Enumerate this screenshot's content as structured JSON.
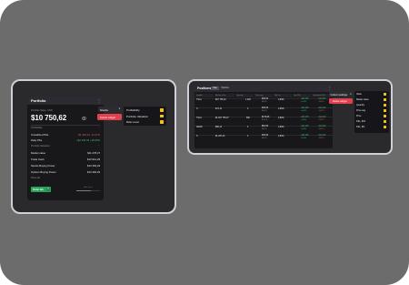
{
  "portfolio": {
    "title": "Portfolio",
    "menu_icon": "kebab-icon",
    "net_value_label": "Portfolio Value, USD",
    "net_value": "$10 750,62",
    "eye_icon": "eye-icon",
    "profitability_section": "Profitability",
    "rows_pl": [
      {
        "label": "Unrealized P&L",
        "value": "-$1 440.94  -13.47%",
        "tone": "neg"
      },
      {
        "label": "Daily P&L",
        "value": "+$2 446.33  +18.66%",
        "tone": "pos"
      }
    ],
    "valuation_section": "Portfolio Valuation",
    "rows_val": [
      {
        "label": "Market value",
        "value": "$11 278,07"
      },
      {
        "label": "Trade Cash",
        "value": "$10 612,29"
      },
      {
        "label": "Stocks Buying Power",
        "value": "$10 393,29"
      },
      {
        "label": "Options Buying Power",
        "value": "$10 393,29"
      }
    ],
    "show_all": "Show all",
    "primary_button": "Order tab",
    "slider_label": "Risk level",
    "slider_fraction": 0.6
  },
  "stocks_dropdown": {
    "label": "Stocks",
    "delete_label": "Delete widget"
  },
  "portfolio_props": [
    {
      "label": "Profitability"
    },
    {
      "label": "Portfolio Valuation"
    },
    {
      "label": "Risk Level"
    }
  ],
  "positions": {
    "title": "Positions",
    "tabs": [
      {
        "label": "Own",
        "active": true
      },
      {
        "label": "Options",
        "active": false
      }
    ],
    "menu_icon": "kebab-icon",
    "columns": [
      "Symbol",
      "Market value",
      "Quantity",
      "Price avg",
      "Net Liq",
      "Day P&L",
      "Unrealized P&L"
    ],
    "rows": [
      {
        "symbol": "TSLA",
        "market": "$67 755,20",
        "qty": "1 000",
        "avg": "$45,05",
        "avg_sub": "$44,16",
        "net": "2,89%",
        "day": "+$2 445",
        "day_sub": "+4,43%",
        "unr": "+$1 020",
        "unr_sub": "-13,47%"
      },
      {
        "symbol": "S",
        "market": "$73,14",
        "qty": "2",
        "avg": "$45,05",
        "avg_sub": "$44,16",
        "net": "2,89%",
        "day": "+$2 445",
        "day_sub": "+4,43%",
        "unr": "+$1 020",
        "unr_sub": "-13,47%"
      },
      {
        "symbol": "TSLA",
        "market": "$1 007 755,07",
        "qty": "800",
        "avg": "$179,08",
        "avg_sub": "$175,41",
        "net": "2,89%",
        "day": "+$2 445",
        "day_sub": "+4,43%",
        "unr": "+$1 020",
        "unr_sub": "-13,47%"
      },
      {
        "symbol": "AMZN",
        "market": "$85,14",
        "qty": "4",
        "avg": "$52,58",
        "avg_sub": "$44,16",
        "net": "2,89%",
        "day": "+$2 445",
        "day_sub": "+4,43%",
        "unr": "+$1 020",
        "unr_sub": "-13,47%"
      },
      {
        "symbol": "S",
        "market": "$1 297,20",
        "qty": "2",
        "avg": "$45,05",
        "avg_sub": "$44,16",
        "net": "2,89%",
        "day": "+$2 445",
        "day_sub": "+4,43%",
        "unr": "+$1 020",
        "unr_sub": "-13,47%"
      }
    ],
    "dropdown_label": "Column settings",
    "delete_label": "Delete widget"
  },
  "column_settings": [
    {
      "label": "Value"
    },
    {
      "label": "Market value"
    },
    {
      "label": "Quantity"
    },
    {
      "label": "Price avg"
    },
    {
      "label": "Price"
    },
    {
      "label": "P&L, $/%"
    },
    {
      "label": "P&L, $%"
    }
  ],
  "colors": {
    "background": "#6c6c6c",
    "widget": "#18181b",
    "accent_yellow": "#f2c21b",
    "danger": "#e0414f",
    "success": "#27a35a"
  }
}
